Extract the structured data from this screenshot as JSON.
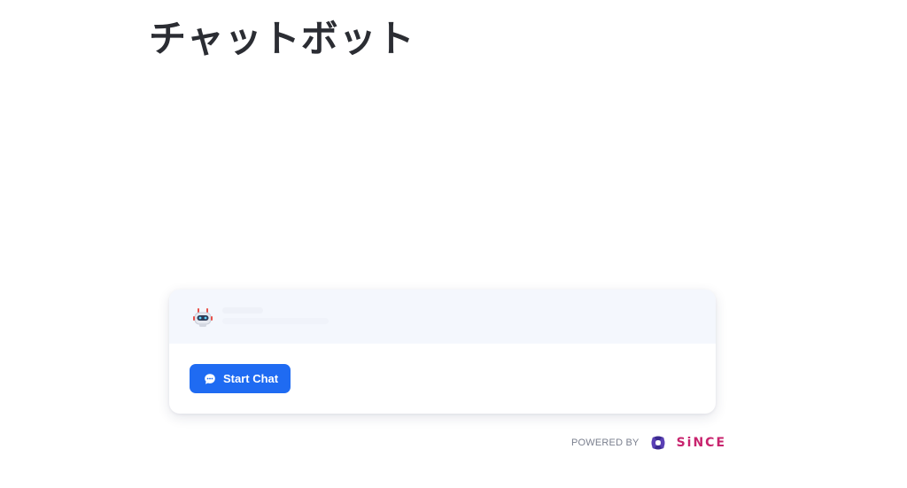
{
  "page": {
    "title": "チャットボット"
  },
  "chat_widget": {
    "avatar_icon": "robot-icon",
    "start_button_icon": "chat-bubble-icon",
    "start_button_label": "Start Chat",
    "accent_color": "#1f6bf2",
    "header_background": "#f4f7fd"
  },
  "footer": {
    "powered_by_label": "POWERED BY",
    "brand_name": "SiNCE",
    "brand_logo_icon": "since-logo-icon",
    "brand_color": "#c8246e",
    "brand_logo_color": "#3b2a8f"
  }
}
